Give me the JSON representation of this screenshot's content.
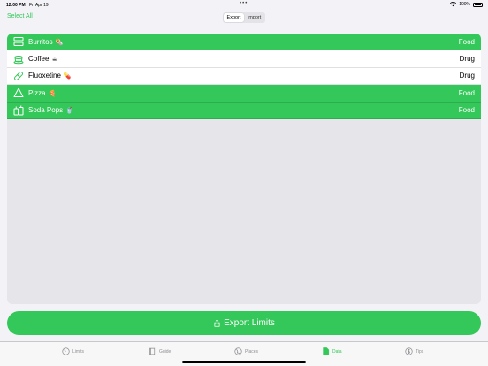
{
  "status_bar": {
    "time": "12:00 PM",
    "date": "Fri Apr 19",
    "battery": "100%",
    "dots": "•••"
  },
  "nav": {
    "select_all": "Select All",
    "segments": [
      {
        "label": "Export",
        "selected": true
      },
      {
        "label": "Import",
        "selected": false
      }
    ]
  },
  "items": [
    {
      "name": "Burritos",
      "emoji": "🌯",
      "type": "Food",
      "selected": true,
      "icon": "food-tray-icon"
    },
    {
      "name": "Coffee",
      "emoji": "☕",
      "type": "Drug",
      "selected": false,
      "icon": "coffee-cup-icon"
    },
    {
      "name": "Fluoxetine",
      "emoji": "💊",
      "type": "Drug",
      "selected": false,
      "icon": "pill-icon"
    },
    {
      "name": "Pizza",
      "emoji": "🍕",
      "type": "Food",
      "selected": true,
      "icon": "pizza-slice-icon"
    },
    {
      "name": "Soda Pops",
      "emoji": "🥤",
      "type": "Food",
      "selected": true,
      "icon": "soda-can-icon"
    }
  ],
  "export_button": {
    "label": "Export Limits",
    "icon": "share-icon"
  },
  "tabs": [
    {
      "label": "Limits",
      "icon": "gauge-icon",
      "active": false
    },
    {
      "label": "Guide",
      "icon": "book-icon",
      "active": false
    },
    {
      "label": "Places",
      "icon": "globe-icon",
      "active": false
    },
    {
      "label": "Data",
      "icon": "document-icon",
      "active": true
    },
    {
      "label": "Tips",
      "icon": "dollar-icon",
      "active": false
    }
  ],
  "colors": {
    "accent": "#34c759",
    "background": "#f2f2f7",
    "panel": "#e5e5ea"
  }
}
